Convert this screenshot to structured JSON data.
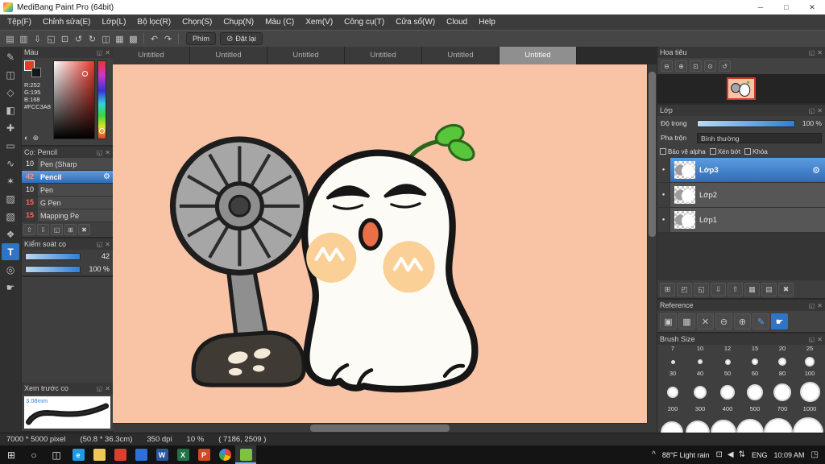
{
  "window": {
    "title": "MediBang Paint Pro (64bit)"
  },
  "menu": {
    "items": [
      "Tệp(F)",
      "Chỉnh sửa(E)",
      "Lớp(L)",
      "Bộ lọc(R)",
      "Chọn(S)",
      "Chụp(N)",
      "Màu (C)",
      "Xem(V)",
      "Công cụ(T)",
      "Cửa sổ(W)",
      "Cloud",
      "Help"
    ]
  },
  "toolbar": {
    "left_icons": [
      "new-file-icon",
      "save-icon",
      "export-icon",
      "copy-icon",
      "paste-icon",
      "rotate-left-icon",
      "rotate-right-icon",
      "flip-icon",
      "grid-icon",
      "material-icon"
    ],
    "keyboard_button": "Phím",
    "reset_button": "Đặt lại"
  },
  "tools": {
    "items": [
      {
        "name": "brush-tool-icon"
      },
      {
        "name": "eraser-tool-icon"
      },
      {
        "name": "smudge-tool-icon"
      },
      {
        "name": "bucket-tool-icon"
      },
      {
        "name": "move-tool-icon"
      },
      {
        "name": "rect-select-tool-icon"
      },
      {
        "name": "lasso-tool-icon"
      },
      {
        "name": "magic-wand-tool-icon"
      },
      {
        "name": "select-pen-tool-icon"
      },
      {
        "name": "select-eraser-tool-icon"
      },
      {
        "name": "operation-tool-icon"
      },
      {
        "name": "text-tool-icon",
        "active": true
      },
      {
        "name": "eyedropper-tool-icon"
      },
      {
        "name": "hand-tool-icon"
      }
    ]
  },
  "tabs": {
    "items": [
      "Untitled",
      "Untitled",
      "Untitled",
      "Untitled",
      "Untitled",
      "Untitled"
    ],
    "active_index": 5
  },
  "color_panel": {
    "title": "Màu",
    "r_label": "R:252",
    "g_label": "G:195",
    "b_label": "B:168",
    "hex": "#FCC3A8",
    "selected_color": "#FCC3A8"
  },
  "brush_panel": {
    "title": "Cọ: Pencil",
    "brushes": [
      {
        "size": "10",
        "name": "Pen (Sharp"
      },
      {
        "size": "42",
        "name": "Pencil",
        "selected": true,
        "size_red": true
      },
      {
        "size": "10",
        "name": "Pen"
      },
      {
        "size": "15",
        "name": "G Pen",
        "size_red": true
      },
      {
        "size": "15",
        "name": "Mapping Pe",
        "size_red": true
      }
    ],
    "bottom_icons": [
      "up-icon",
      "down-icon",
      "duplicate-icon",
      "add-brush-icon",
      "delete-brush-icon"
    ]
  },
  "brush_control": {
    "title": "Kiểm soát cọ",
    "size_value": "42",
    "opacity_value": "100 %"
  },
  "brush_preview": {
    "title": "Xem trước cọ",
    "size_label": "3.08mm"
  },
  "navigator": {
    "title": "Hoa tiêu",
    "zoom_icons": [
      "zoom-out-icon",
      "zoom-in-icon",
      "fit-window-icon",
      "actual-size-icon",
      "rotate-reset-icon"
    ]
  },
  "layers_panel": {
    "title": "Lớp",
    "opacity_label": "Độ trong",
    "opacity_value": "100 %",
    "blend_label": "Pha trộn",
    "blend_value": "Bình thường",
    "checkboxes": [
      "Bảo vệ alpha",
      "Xén bớt",
      "Khóa"
    ],
    "layers": [
      {
        "name": "Lớp3",
        "selected": true
      },
      {
        "name": "Lớp2"
      },
      {
        "name": "Lớp1"
      }
    ],
    "bottom_icons": [
      "new-layer-icon",
      "new-folder-icon",
      "duplicate-layer-icon",
      "merge-down-icon",
      "transfer-icon",
      "layer-mask-icon",
      "layer-settings-icon",
      "delete-layer-icon"
    ]
  },
  "reference_panel": {
    "title": "Reference",
    "icons": [
      {
        "name": "image-icon"
      },
      {
        "name": "ref-grid-icon"
      },
      {
        "name": "ref-clear-icon"
      },
      {
        "name": "ref-zoom-out-icon"
      },
      {
        "name": "ref-zoom-in-icon"
      },
      {
        "name": "ref-pencil-icon",
        "accent": true
      },
      {
        "name": "ref-hand-icon",
        "active": true
      }
    ]
  },
  "brush_size_panel": {
    "title": "Brush Size",
    "rows": [
      {
        "labels": [
          "7",
          "10",
          "12",
          "15",
          "20",
          "25"
        ],
        "diameters": [
          5,
          6,
          7,
          8,
          10,
          12
        ]
      },
      {
        "labels": [
          "30",
          "40",
          "50",
          "60",
          "80",
          "100"
        ],
        "diameters": [
          14,
          16,
          18,
          20,
          22,
          25
        ]
      },
      {
        "labels": [
          "200",
          "300",
          "400",
          "500",
          "700",
          "1000"
        ],
        "diameters": [
          28,
          30,
          32,
          34,
          36,
          38
        ]
      }
    ]
  },
  "statusbar": {
    "segments": [
      "7000 * 5000 pixel",
      "(50.8 * 36.3cm)",
      "350 dpi",
      "10 %",
      "( 7186, 2509 )"
    ]
  },
  "taskbar": {
    "system_icons": [
      "start-icon",
      "search-icon",
      "task-view-icon"
    ],
    "apps": [
      {
        "name": "edge-icon",
        "label": "e",
        "color": "#1e9be2"
      },
      {
        "name": "file-explorer-icon",
        "label": "",
        "color": "#f0c85a"
      },
      {
        "name": "photos-icon",
        "label": "",
        "color": "#d8402f"
      },
      {
        "name": "store-icon",
        "label": "",
        "color": "#2f6fd8"
      },
      {
        "name": "word-icon",
        "label": "W",
        "color": "#2b579a"
      },
      {
        "name": "excel-icon",
        "label": "X",
        "color": "#217346"
      },
      {
        "name": "powerpoint-icon",
        "label": "P",
        "color": "#d24726"
      },
      {
        "name": "chrome-icon",
        "label": "",
        "color": ""
      },
      {
        "name": "medibang-icon",
        "label": "",
        "color": "#7dc242",
        "active": true
      }
    ],
    "weather": "88°F Light rain",
    "tray_icons": [
      "display-icon",
      "speaker-icon",
      "network-icon"
    ],
    "language": "ENG",
    "time": "10:09 AM"
  },
  "canvas": {
    "background": "#f9c3a6"
  }
}
